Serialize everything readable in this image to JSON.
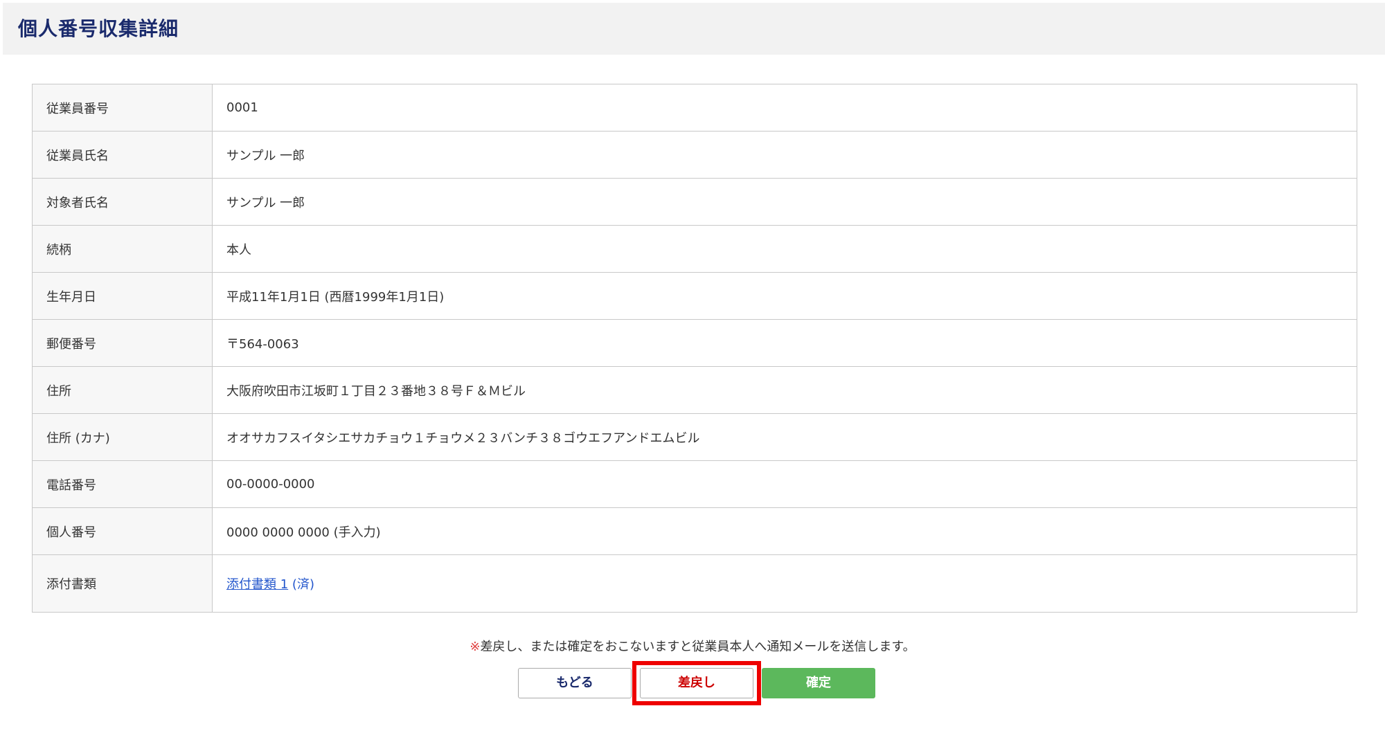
{
  "header": {
    "title": "個人番号収集詳細"
  },
  "details": [
    {
      "label": "従業員番号",
      "value": "0001"
    },
    {
      "label": "従業員氏名",
      "value": "サンプル 一郎"
    },
    {
      "label": "対象者氏名",
      "value": "サンプル 一郎"
    },
    {
      "label": "続柄",
      "value": "本人"
    },
    {
      "label": "生年月日",
      "value": "平成11年1月1日 (西暦1999年1月1日)"
    },
    {
      "label": "郵便番号",
      "value": "〒564-0063"
    },
    {
      "label": "住所",
      "value": "大阪府吹田市江坂町１丁目２３番地３８号Ｆ＆Ｍビル"
    },
    {
      "label": "住所 (カナ)",
      "value": "オオサカフスイタシエサカチョウ１チョウメ２３バンチ３８ゴウエフアンドエムビル"
    },
    {
      "label": "電話番号",
      "value": "00-0000-0000"
    },
    {
      "label": "個人番号",
      "value": "0000 0000 0000 (手入力)"
    }
  ],
  "attachment": {
    "label": "添付書類",
    "link_text": "添付書類 1",
    "status": "(済)"
  },
  "notice": {
    "mark": "※",
    "text": "差戻し、または確定をおこないますと従業員本人へ通知メールを送信します。"
  },
  "buttons": {
    "back": "もどる",
    "return": "差戻し",
    "confirm": "確定"
  },
  "colors": {
    "title": "#1a2a6c",
    "header_bg": "#f2f2f2",
    "confirm_bg": "#5cb85c",
    "return_text": "#cc0000",
    "highlight": "#ee0000",
    "link": "#2255cc"
  }
}
